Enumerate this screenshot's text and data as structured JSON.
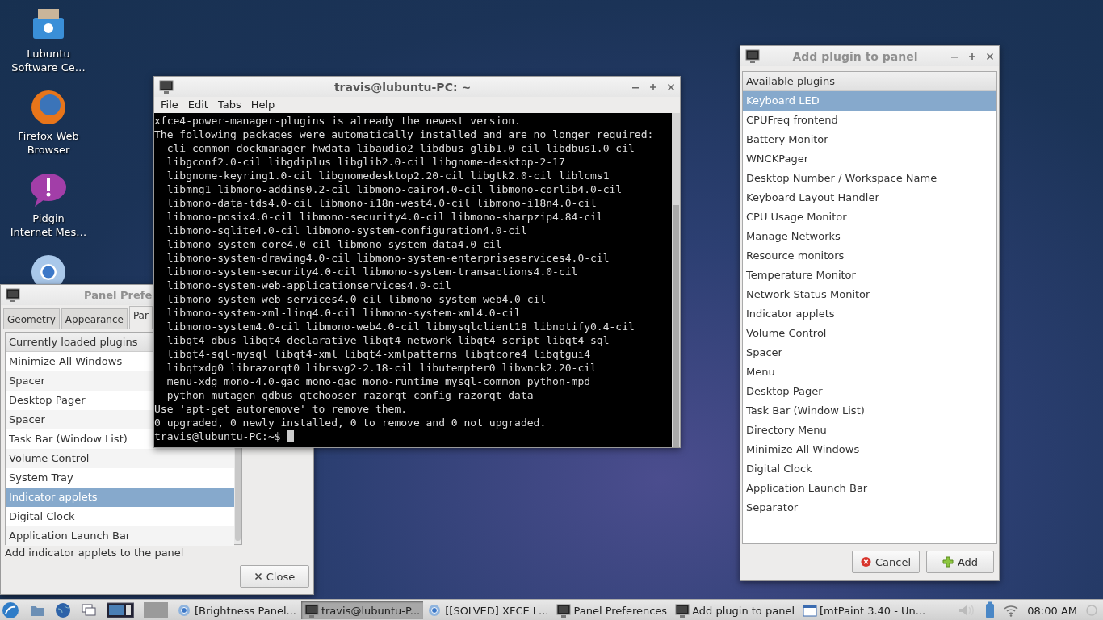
{
  "desktop_icons": [
    {
      "kind": "software",
      "lines": [
        "Lubuntu",
        "Software Ce…"
      ]
    },
    {
      "kind": "firefox",
      "lines": [
        "Firefox Web",
        "Browser"
      ]
    },
    {
      "kind": "pidgin",
      "lines": [
        "Pidgin",
        "Internet Mes…"
      ]
    },
    {
      "kind": "chromium"
    }
  ],
  "panel_preferences": {
    "title": "Panel Prefe",
    "tabs": [
      {
        "label": "Geometry",
        "selected": false
      },
      {
        "label": "Appearance",
        "selected": false
      },
      {
        "label": "Par",
        "selected": true
      }
    ],
    "list_header": "Currently loaded plugins",
    "items": [
      {
        "label": "Minimize All Windows",
        "selected": false
      },
      {
        "label": "Spacer",
        "selected": false
      },
      {
        "label": "Desktop Pager",
        "selected": false
      },
      {
        "label": "Spacer",
        "selected": false
      },
      {
        "label": "Task Bar (Window List)",
        "selected": false
      },
      {
        "label": "Volume Control",
        "selected": false
      },
      {
        "label": "System Tray",
        "selected": false
      },
      {
        "label": "Indicator applets",
        "selected": true
      },
      {
        "label": "Digital Clock",
        "selected": false
      },
      {
        "label": "Application Launch Bar",
        "selected": false
      }
    ],
    "description": "Add indicator applets to the panel",
    "close_button": "Close"
  },
  "terminal": {
    "title": "travis@lubuntu-PC: ~",
    "menu": [
      "File",
      "Edit",
      "Tabs",
      "Help"
    ],
    "lines": [
      "xfce4-power-manager-plugins is already the newest version.",
      "The following packages were automatically installed and are no longer required:",
      "  cli-common dockmanager hwdata libaudio2 libdbus-glib1.0-cil libdbus1.0-cil",
      "  libgconf2.0-cil libgdiplus libglib2.0-cil libgnome-desktop-2-17",
      "  libgnome-keyring1.0-cil libgnomedesktop2.20-cil libgtk2.0-cil liblcms1",
      "  libmng1 libmono-addins0.2-cil libmono-cairo4.0-cil libmono-corlib4.0-cil",
      "  libmono-data-tds4.0-cil libmono-i18n-west4.0-cil libmono-i18n4.0-cil",
      "  libmono-posix4.0-cil libmono-security4.0-cil libmono-sharpzip4.84-cil",
      "  libmono-sqlite4.0-cil libmono-system-configuration4.0-cil",
      "  libmono-system-core4.0-cil libmono-system-data4.0-cil",
      "  libmono-system-drawing4.0-cil libmono-system-enterpriseservices4.0-cil",
      "  libmono-system-security4.0-cil libmono-system-transactions4.0-cil",
      "  libmono-system-web-applicationservices4.0-cil",
      "  libmono-system-web-services4.0-cil libmono-system-web4.0-cil",
      "  libmono-system-xml-linq4.0-cil libmono-system-xml4.0-cil",
      "  libmono-system4.0-cil libmono-web4.0-cil libmysqlclient18 libnotify0.4-cil",
      "  libqt4-dbus libqt4-declarative libqt4-network libqt4-script libqt4-sql",
      "  libqt4-sql-mysql libqt4-xml libqt4-xmlpatterns libqtcore4 libqtgui4",
      "  libqtxdg0 librazorqt0 librsvg2-2.18-cil libutempter0 libwnck2.20-cil",
      "  menu-xdg mono-4.0-gac mono-gac mono-runtime mysql-common python-mpd",
      "  python-mutagen qdbus qtchooser razorqt-config razorqt-data",
      "Use 'apt-get autoremove' to remove them.",
      "0 upgraded, 0 newly installed, 0 to remove and 0 not upgraded."
    ],
    "prompt": "travis@lubuntu-PC:~$"
  },
  "add_plugin": {
    "title": "Add plugin to panel",
    "list_header": "Available plugins",
    "items": [
      {
        "label": "Keyboard LED",
        "selected": true
      },
      {
        "label": "CPUFreq frontend",
        "selected": false
      },
      {
        "label": "Battery Monitor",
        "selected": false
      },
      {
        "label": "WNCKPager",
        "selected": false
      },
      {
        "label": "Desktop Number / Workspace Name",
        "selected": false
      },
      {
        "label": "Keyboard Layout Handler",
        "selected": false
      },
      {
        "label": "CPU Usage Monitor",
        "selected": false
      },
      {
        "label": "Manage Networks",
        "selected": false
      },
      {
        "label": "Resource monitors",
        "selected": false
      },
      {
        "label": "Temperature Monitor",
        "selected": false
      },
      {
        "label": "Network Status Monitor",
        "selected": false
      },
      {
        "label": "Indicator applets",
        "selected": false
      },
      {
        "label": "Volume Control",
        "selected": false
      },
      {
        "label": "Spacer",
        "selected": false
      },
      {
        "label": "Menu",
        "selected": false
      },
      {
        "label": "Desktop Pager",
        "selected": false
      },
      {
        "label": "Task Bar (Window List)",
        "selected": false
      },
      {
        "label": "Directory Menu",
        "selected": false
      },
      {
        "label": "Minimize All Windows",
        "selected": false
      },
      {
        "label": "Digital Clock",
        "selected": false
      },
      {
        "label": "Application Launch Bar",
        "selected": false
      },
      {
        "label": "Separator",
        "selected": false
      }
    ],
    "cancel_button": "Cancel",
    "add_button": "Add"
  },
  "taskbar": {
    "tasks": [
      {
        "kind": "browser",
        "label": "[Brightness Panel...",
        "selected": false
      },
      {
        "kind": "terminal",
        "label": "travis@lubuntu-P...",
        "selected": true
      },
      {
        "kind": "browser",
        "label": "[[SOLVED] XFCE L...",
        "selected": false
      },
      {
        "kind": "terminal",
        "label": "Panel Preferences",
        "selected": false
      },
      {
        "kind": "terminal",
        "label": "Add plugin to panel",
        "selected": false
      },
      {
        "kind": "paint",
        "label": "[mtPaint 3.40 - Un...",
        "selected": false
      }
    ],
    "clock": "08:00 AM"
  }
}
